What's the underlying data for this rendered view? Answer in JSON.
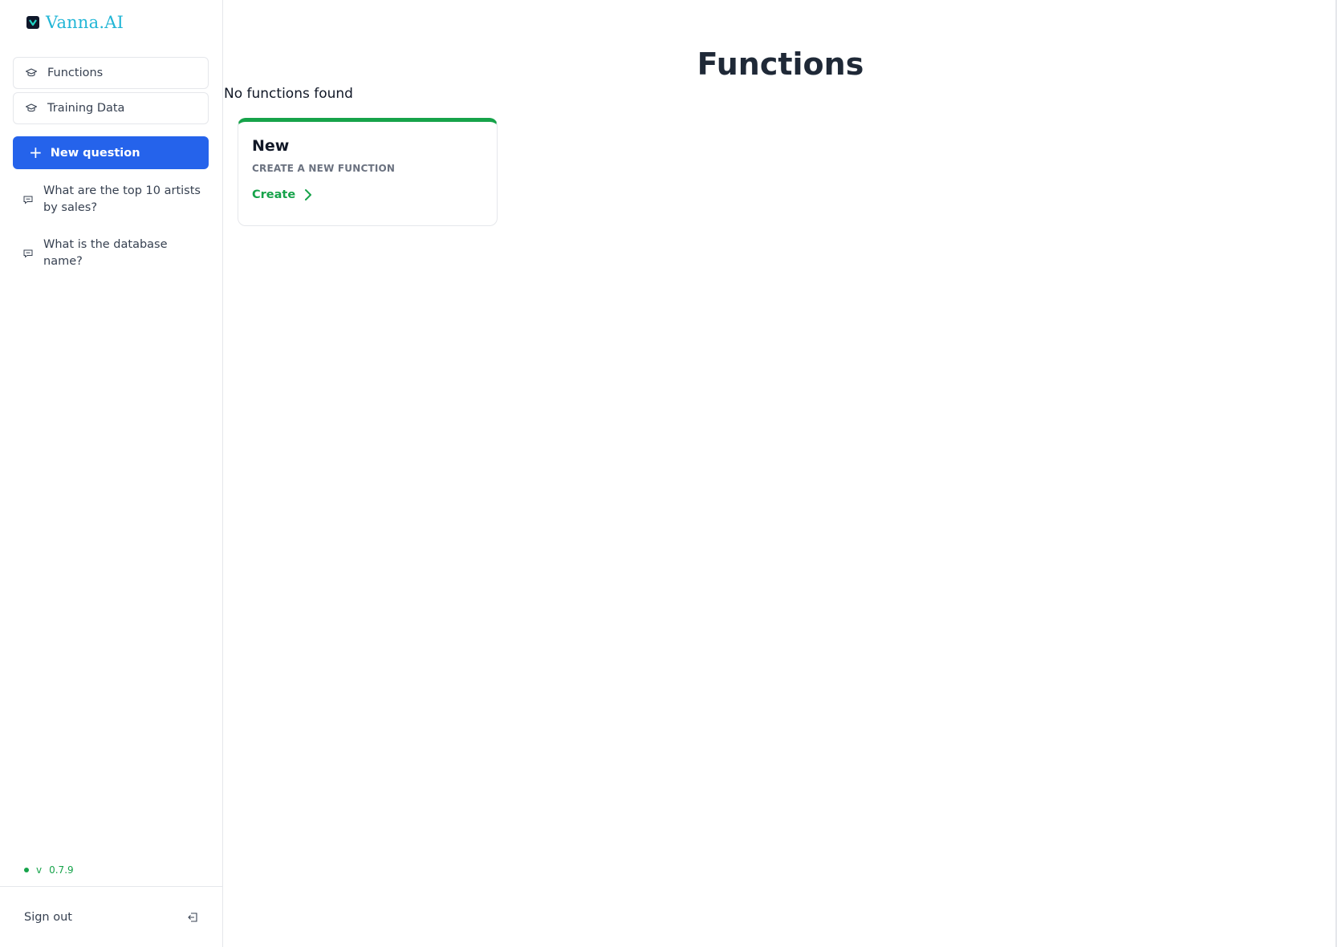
{
  "brand": {
    "name": "Vanna.AI",
    "accent_color": "#22b6d6"
  },
  "sidebar": {
    "nav": [
      {
        "label": "Functions",
        "icon": "graduation-cap-icon"
      },
      {
        "label": "Training Data",
        "icon": "graduation-cap-icon"
      }
    ],
    "new_question_label": "New question",
    "history": [
      {
        "label": "What are the top 10 artists by sales?",
        "icon": "chat-bubble-icon"
      },
      {
        "label": "What is the database name?",
        "icon": "chat-bubble-icon"
      }
    ],
    "version_prefix": "v",
    "version": "0.7.9",
    "sign_out_label": "Sign out"
  },
  "main": {
    "title": "Functions",
    "empty_message": "No functions found",
    "card": {
      "title": "New",
      "subtitle": "CREATE A NEW FUNCTION",
      "action_label": "Create",
      "accent_color": "#16a34a"
    }
  },
  "colors": {
    "primary": "#2563eb",
    "success": "#16a34a"
  }
}
